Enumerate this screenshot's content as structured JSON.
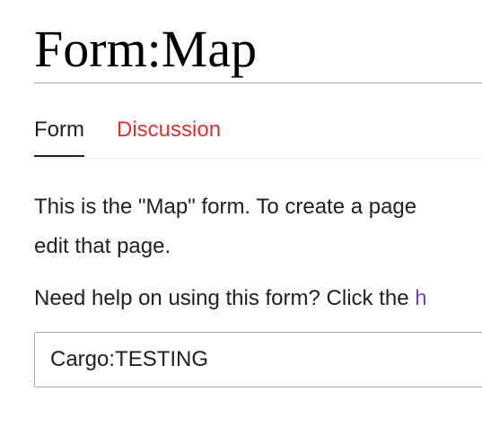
{
  "page": {
    "title": "Form:Map"
  },
  "tabs": [
    {
      "label": "Form",
      "selected": true
    },
    {
      "label": "Discussion",
      "selected": false
    }
  ],
  "content": {
    "intro_line1": "This is the \"Map\" form. To create a page",
    "intro_line2": "edit that page.",
    "help_text": "Need help on using this form? Click the ",
    "help_link_text": "h"
  },
  "page_input": {
    "value": "Cargo:TESTING"
  },
  "colors": {
    "text": "#202122",
    "link_red": "#d73333",
    "link_visited": "#6b4ba1",
    "border": "#a2a9b1"
  }
}
